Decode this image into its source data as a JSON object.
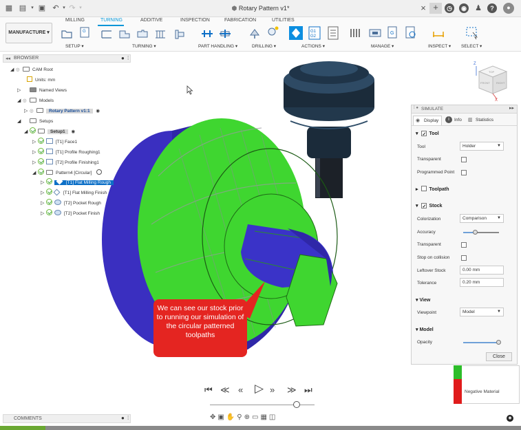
{
  "titlebar": {
    "doc_title": "Rotary Pattern v1*",
    "close_glyph": "×",
    "plus_glyph": "+",
    "icons": [
      "grid-icon",
      "file-icon",
      "save-icon",
      "undo-icon",
      "redo-icon",
      "cube-icon",
      "clock-icon",
      "bell-icon",
      "help-icon",
      "user-icon"
    ]
  },
  "ribbon": {
    "workspace": "MANUFACTURE",
    "tabs": [
      "MILLING",
      "TURNING",
      "ADDITIVE",
      "INSPECTION",
      "FABRICATION",
      "UTILITIES"
    ],
    "active_tab": "TURNING",
    "groups": [
      "SETUP",
      "TURNING",
      "PART HANDLING",
      "DRILLING",
      "ACTIONS",
      "MANAGE",
      "INSPECT",
      "SELECT"
    ],
    "g_label": "G",
    "g1g2_label": "G1\nG2"
  },
  "browser": {
    "header": "BROWSER",
    "items": [
      {
        "label": "CAM Root"
      },
      {
        "label": "Units: mm"
      },
      {
        "label": "Named Views"
      },
      {
        "label": "Models"
      },
      {
        "label": "Rotary Pattern v1:1"
      },
      {
        "label": "Setups"
      },
      {
        "label": "Setup1"
      },
      {
        "label": "[T1] Face1"
      },
      {
        "label": "[T1] Profile Roughing1"
      },
      {
        "label": "[T2] Profile Finishing1"
      },
      {
        "label": "Pattern4 [Circular]"
      },
      {
        "label": "[T1] Flat Milling Rough"
      },
      {
        "label": "[T1] Flat Milling Finish"
      },
      {
        "label": "[T2] Pocket Rough"
      },
      {
        "label": "[T2] Pocket Finish"
      }
    ]
  },
  "viewcube": {
    "top": "TOP",
    "front": "FRONT",
    "right": "RIGHT",
    "axis_z": "Z",
    "axis_x": "X"
  },
  "simulate": {
    "title": "SIMULATE",
    "tabs": [
      "Display",
      "Info",
      "Statistics"
    ],
    "tool_section": "Tool",
    "tool_label": "Tool",
    "tool_value": "Holder",
    "transparent_label": "Transparent",
    "programmed_point_label": "Programmed Point",
    "toolpath_section": "Toolpath",
    "stock_section": "Stock",
    "colorization_label": "Colorization",
    "colorization_value": "Comparison",
    "accuracy_label": "Accuracy",
    "accuracy_level": 0.35,
    "stock_transparent_label": "Transparent",
    "stop_on_collision_label": "Stop on collision",
    "leftover_stock_label": "Leftover Stock",
    "leftover_stock_value": "0.00 mm",
    "tolerance_label": "Tolerance",
    "tolerance_value": "0.20 mm",
    "view_section": "View",
    "viewpoint_label": "Viewpoint",
    "viewpoint_value": "Model",
    "model_section": "Model",
    "opacity_label": "Opacity",
    "opacity_level": 1.0,
    "close_label": "Close"
  },
  "legend": {
    "negative_material": "Negative Material"
  },
  "callout": {
    "text": "We can see our stock prior to running our simulation of the circular patterned toolpaths"
  },
  "comments": {
    "label": "COMMENTS"
  },
  "colors": {
    "accent": "#0696d7",
    "stock_green": "#3fd630",
    "part_blue": "#3a33c8",
    "callout_red": "#e42521",
    "tool_dark": "#1b2b3a"
  }
}
